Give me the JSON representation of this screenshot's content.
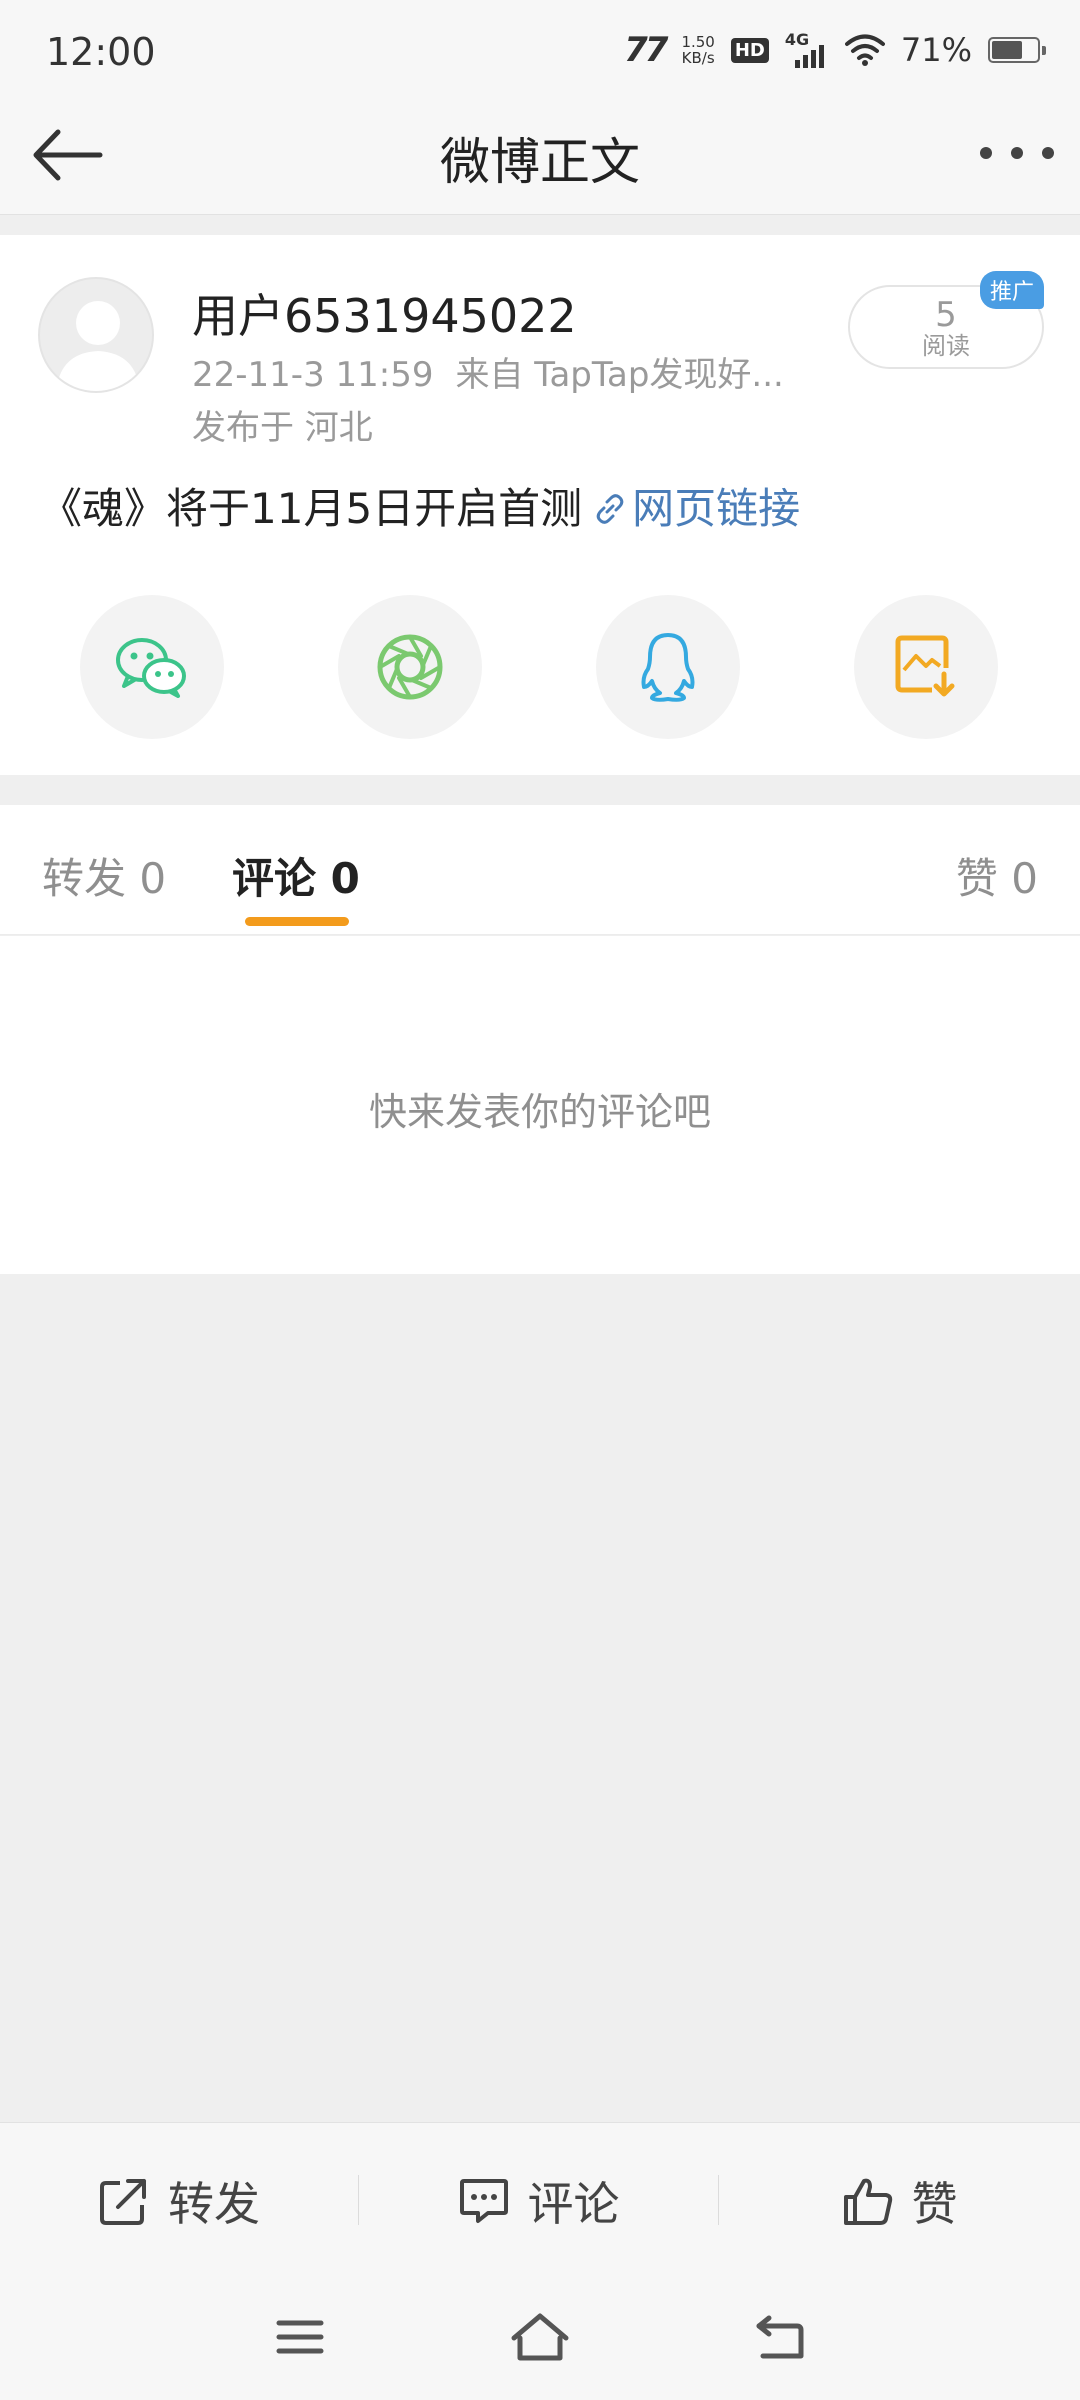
{
  "status_bar": {
    "time": "12:00",
    "carrier_icon": "77",
    "net_speed_value": "1.50",
    "net_speed_unit": "KB/s",
    "hd_label": "HD",
    "network_label": "4G",
    "battery_percent": "71%",
    "battery_level": 0.71
  },
  "header": {
    "title": "微博正文",
    "back_icon": "arrow-left",
    "more_icon": "ellipsis-horizontal"
  },
  "post": {
    "username": "用户6531945022",
    "time": "22-11-3 11:59",
    "source": "来自 TapTap发现好...",
    "location": "发布于 河北",
    "read_count": "5",
    "read_label": "阅读",
    "promo_badge": "推广",
    "text": "《魂》将于11月5日开启首测",
    "link_text": "网页链接",
    "share_icons": [
      "wechat-icon",
      "moments-icon",
      "qq-icon",
      "save-image-icon"
    ],
    "colors": {
      "wechat": "#3cc48a",
      "moments": "#7bc96f",
      "qq": "#34a9e0",
      "save": "#f2a922",
      "link": "#4a7db8"
    }
  },
  "tabs": {
    "repost": "转发 0",
    "comment": "评论 0",
    "like": "赞 0",
    "active": "comment",
    "accent": "#f39b1c"
  },
  "comments": {
    "empty_text": "快来发表你的评论吧"
  },
  "action_bar": {
    "repost": "转发",
    "comment": "评论",
    "like": "赞"
  },
  "system_nav": [
    "menu-icon",
    "home-icon",
    "back-icon"
  ]
}
